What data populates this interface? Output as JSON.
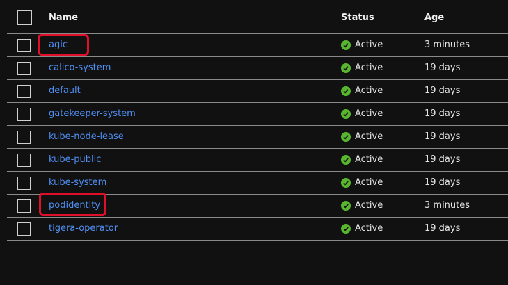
{
  "table": {
    "headers": {
      "name": "Name",
      "status": "Status",
      "age": "Age"
    },
    "rows": [
      {
        "name": "agic",
        "status": "Active",
        "age": "3 minutes",
        "highlighted": true
      },
      {
        "name": "calico-system",
        "status": "Active",
        "age": "19 days",
        "highlighted": false
      },
      {
        "name": "default",
        "status": "Active",
        "age": "19 days",
        "highlighted": false
      },
      {
        "name": "gatekeeper-system",
        "status": "Active",
        "age": "19 days",
        "highlighted": false
      },
      {
        "name": "kube-node-lease",
        "status": "Active",
        "age": "19 days",
        "highlighted": false
      },
      {
        "name": "kube-public",
        "status": "Active",
        "age": "19 days",
        "highlighted": false
      },
      {
        "name": "kube-system",
        "status": "Active",
        "age": "19 days",
        "highlighted": false
      },
      {
        "name": "podidentity",
        "status": "Active",
        "age": "3 minutes",
        "highlighted": true
      },
      {
        "name": "tigera-operator",
        "status": "Active",
        "age": "19 days",
        "highlighted": false
      }
    ]
  },
  "icons": {
    "status_active": "check-circle-icon"
  },
  "colors": {
    "background": "#121112",
    "link": "#4f8ff2",
    "status_ok": "#58b62e",
    "highlight": "#e0102a"
  }
}
